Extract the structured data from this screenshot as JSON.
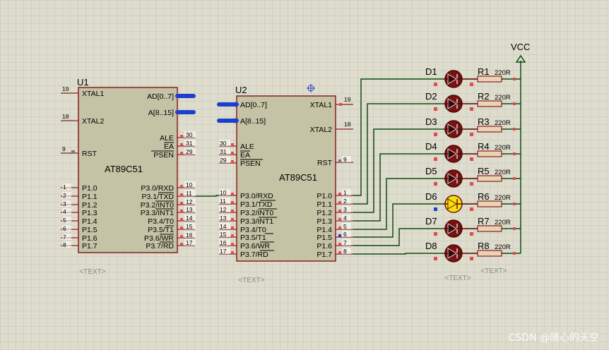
{
  "colors": {
    "background": "#dedccd",
    "grid": "#c6c3b2",
    "chip_fill": "#c4c3a5",
    "chip_border": "#8a1f1f",
    "wire": "#0e4d12",
    "bus": "#1d3fcf",
    "led_off": "#7a1111",
    "led_on": "#f0e20e",
    "pin_square": "#e14b4b",
    "text": "#000000"
  },
  "u1": {
    "ref": "U1",
    "part": "AT89C51",
    "text_placeholder": "<TEXT>",
    "left_pins": [
      {
        "num": "19",
        "name": "XTAL1"
      },
      {
        "num": "18",
        "name": "XTAL2"
      },
      {
        "num": "9",
        "name": "RST"
      },
      {
        "num": "1",
        "name": "P1.0"
      },
      {
        "num": "2",
        "name": "P1.1"
      },
      {
        "num": "3",
        "name": "P1.2"
      },
      {
        "num": "4",
        "name": "P1.3"
      },
      {
        "num": "5",
        "name": "P1.4"
      },
      {
        "num": "6",
        "name": "P1.5"
      },
      {
        "num": "7",
        "name": "P1.6"
      },
      {
        "num": "8",
        "name": "P1.7"
      }
    ],
    "right_pins": [
      {
        "num": "",
        "name": "AD[0..7]"
      },
      {
        "num": "",
        "name": "A[8..15]"
      },
      {
        "num": "30",
        "name": "ALE"
      },
      {
        "num": "31",
        "name": "EA"
      },
      {
        "num": "29",
        "name": "PSEN"
      },
      {
        "num": "10",
        "name": "P3.0/RXD"
      },
      {
        "num": "11",
        "name": "P3.1/TXD"
      },
      {
        "num": "12",
        "name": "P3.2/INT0"
      },
      {
        "num": "13",
        "name": "P3.3/INT1"
      },
      {
        "num": "14",
        "name": "P3.4/T0"
      },
      {
        "num": "15",
        "name": "P3.5/T1"
      },
      {
        "num": "16",
        "name": "P3.6/WR"
      },
      {
        "num": "17",
        "name": "P3.7/RD"
      }
    ]
  },
  "u2": {
    "ref": "U2",
    "part": "AT89C51",
    "text_placeholder": "<TEXT>",
    "left_pins": [
      {
        "num": "",
        "name": "AD[0..7]"
      },
      {
        "num": "",
        "name": "A[8..15]"
      },
      {
        "num": "30",
        "name": "ALE"
      },
      {
        "num": "31",
        "name": "EA"
      },
      {
        "num": "29",
        "name": "PSEN"
      },
      {
        "num": "10",
        "name": "P3.0/RXD"
      },
      {
        "num": "11",
        "name": "P3.1/TXD"
      },
      {
        "num": "12",
        "name": "P3.2/INT0"
      },
      {
        "num": "13",
        "name": "P3.3/INT1"
      },
      {
        "num": "14",
        "name": "P3.4/T0"
      },
      {
        "num": "15",
        "name": "P3.5/T1"
      },
      {
        "num": "16",
        "name": "P3.6/WR"
      },
      {
        "num": "17",
        "name": "P3.7/RD"
      }
    ],
    "right_pins": [
      {
        "num": "19",
        "name": "XTAL1"
      },
      {
        "num": "18",
        "name": "XTAL2"
      },
      {
        "num": "9",
        "name": "RST"
      },
      {
        "num": "1",
        "name": "P1.0"
      },
      {
        "num": "2",
        "name": "P1.1"
      },
      {
        "num": "3",
        "name": "P1.2"
      },
      {
        "num": "4",
        "name": "P1.3"
      },
      {
        "num": "5",
        "name": "P1.4"
      },
      {
        "num": "6",
        "name": "P1.5"
      },
      {
        "num": "7",
        "name": "P1.6"
      },
      {
        "num": "8",
        "name": "P1.7"
      }
    ]
  },
  "leds": [
    {
      "ref": "D1",
      "lit": false
    },
    {
      "ref": "D2",
      "lit": false
    },
    {
      "ref": "D3",
      "lit": false
    },
    {
      "ref": "D4",
      "lit": false
    },
    {
      "ref": "D5",
      "lit": false
    },
    {
      "ref": "D6",
      "lit": true
    },
    {
      "ref": "D7",
      "lit": false
    },
    {
      "ref": "D8",
      "lit": false
    }
  ],
  "resistors": [
    {
      "ref": "R1",
      "value": "220R"
    },
    {
      "ref": "R2",
      "value": "220R"
    },
    {
      "ref": "R3",
      "value": "220R"
    },
    {
      "ref": "R4",
      "value": "220R"
    },
    {
      "ref": "R5",
      "value": "220R"
    },
    {
      "ref": "R6",
      "value": "220R"
    },
    {
      "ref": "R7",
      "value": "220R"
    },
    {
      "ref": "R8",
      "value": "220R"
    }
  ],
  "vcc_label": "VCC",
  "led_text_placeholder": "<TEXT>",
  "res_text_placeholder": "<TEXT>",
  "watermark": "CSDN @随心的天空"
}
